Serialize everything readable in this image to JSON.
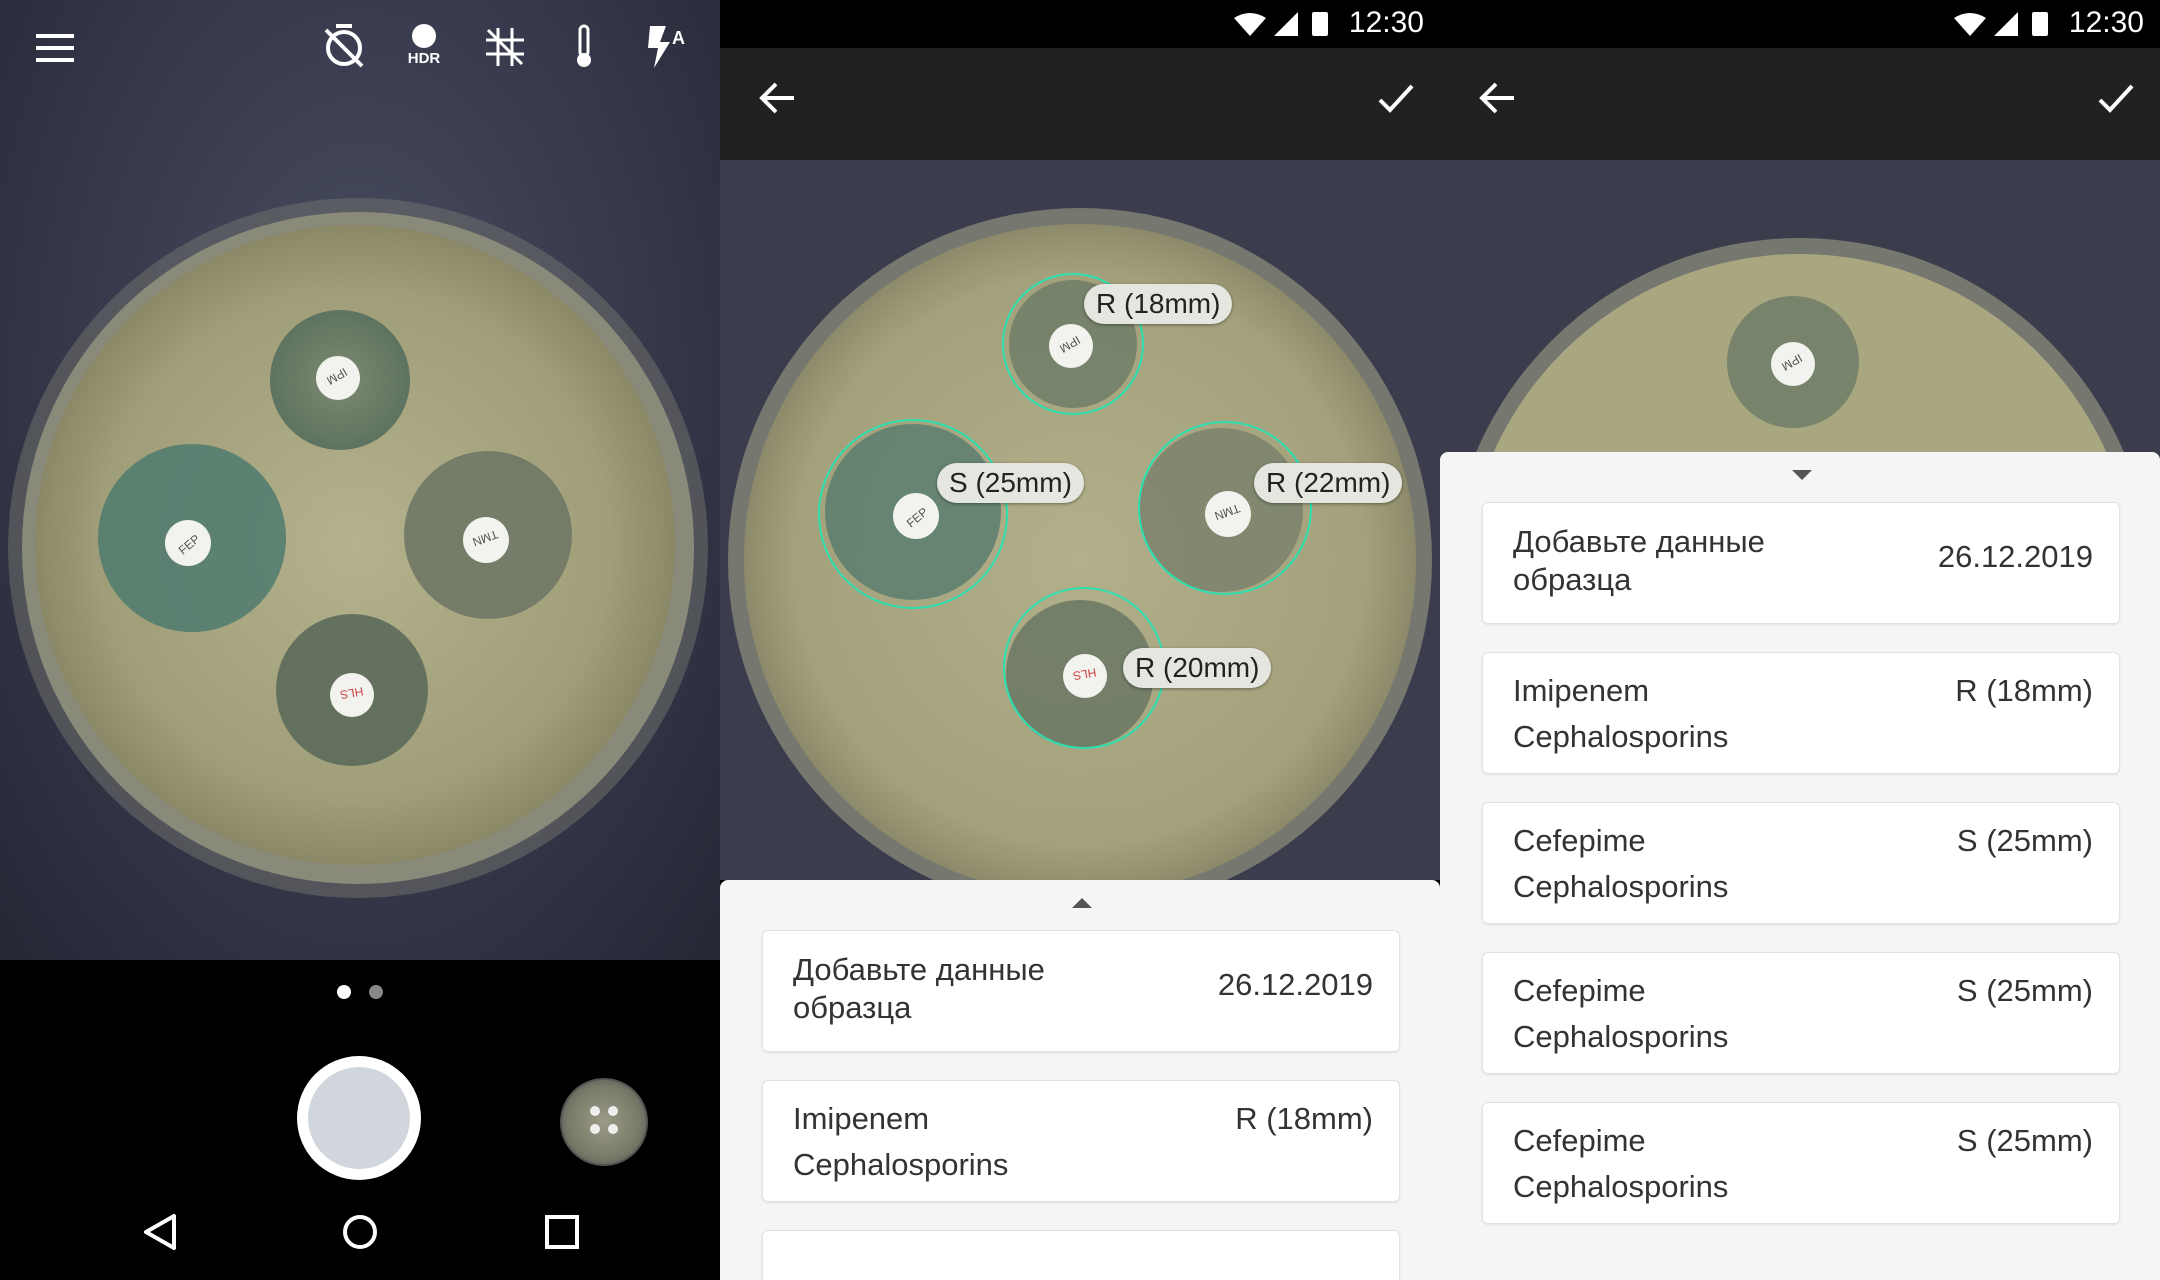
{
  "camera": {
    "icons": [
      "menu-icon",
      "timer-off-icon",
      "hdr-icon",
      "grid-off-icon",
      "thermometer-icon",
      "flash-auto-icon"
    ],
    "hdr_label": "HDR",
    "pager_active": 0,
    "pager_count": 2
  },
  "disk_labels": [
    "IPM",
    "FEP",
    "TMN",
    "HLS"
  ],
  "results_screen": {
    "time": "12:30",
    "zones": [
      {
        "label": "R (18mm)"
      },
      {
        "label": "S (25mm)"
      },
      {
        "label": "R (22mm)"
      },
      {
        "label": "R (20mm)"
      }
    ],
    "sample_card": {
      "title": "Добавьте данные образца",
      "date": "26.12.2019"
    },
    "items": [
      {
        "name": "Imipenem",
        "group": "Cephalosporins",
        "result": "R (18mm)"
      }
    ]
  },
  "list_screen": {
    "time": "12:30",
    "sample_card": {
      "title": "Добавьте данные образца",
      "date": "26.12.2019"
    },
    "items": [
      {
        "name": "Imipenem",
        "group": "Cephalosporins",
        "result": "R (18mm)"
      },
      {
        "name": "Cefepime",
        "group": "Cephalosporins",
        "result": "S (25mm)"
      },
      {
        "name": "Cefepime",
        "group": "Cephalosporins",
        "result": "S (25mm)"
      },
      {
        "name": "Cefepime",
        "group": "Cephalosporins",
        "result": "S (25mm)"
      }
    ]
  },
  "colors": {
    "toolbar": "#212121",
    "zone_circle": "#2de0b0",
    "sheet_bg": "#f5f5f5",
    "agar": "#a3a17c"
  }
}
